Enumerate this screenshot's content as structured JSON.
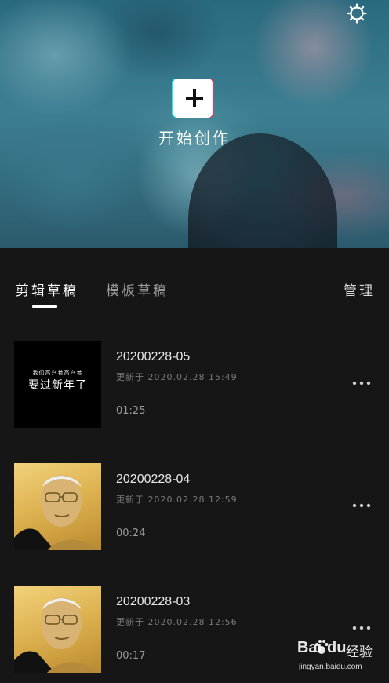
{
  "hero": {
    "create_label": "开始创作",
    "create_icon": "plus-icon",
    "settings_icon": "settings-gear-icon"
  },
  "tabs": {
    "edit_drafts": "剪辑草稿",
    "template_drafts": "模板草稿",
    "manage": "管理",
    "active": "剪辑草稿"
  },
  "drafts": [
    {
      "title": "20200228-05",
      "updated": "更新于 2020.02.28 15:49",
      "duration": "01:25",
      "thumb_small_text": "我们高兴着高兴着",
      "thumb_big_text": "要过新年了"
    },
    {
      "title": "20200228-04",
      "updated": "更新于 2020.02.28 12:59",
      "duration": "00:24"
    },
    {
      "title": "20200228-03",
      "updated": "更新于 2020.02.28 12:56",
      "duration": "00:17"
    }
  ],
  "more_icon": "more-dots-icon",
  "watermark": {
    "bai": "Bai",
    "du": "du",
    "jingyan": "经验",
    "domain": "jingyan.baidu.com"
  },
  "colors": {
    "background": "#161616",
    "accent_red": "#fe2c55",
    "accent_cyan": "#25f4ee",
    "portrait_gold": "#d9ac4a"
  }
}
